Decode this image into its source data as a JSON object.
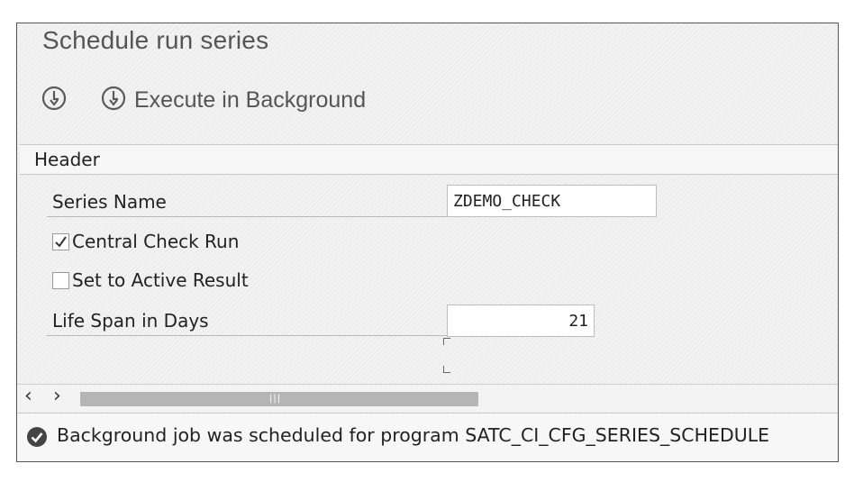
{
  "window": {
    "title": "Schedule run series"
  },
  "toolbar": {
    "execute_button_label": "Execute in Background",
    "execute_icon": "execute-clock-icon",
    "schedule_icon": "execute-clock-icon"
  },
  "header": {
    "title": "Header",
    "series_name": {
      "label": "Series Name",
      "value": "ZDEMO_CHECK"
    },
    "central_check_run": {
      "label": "Central Check Run",
      "checked": true
    },
    "set_active_result": {
      "label": "Set to Active Result",
      "checked": false
    },
    "life_span": {
      "label": "Life Span in Days",
      "value": "21"
    }
  },
  "scrollbar": {
    "left_arrow": "‹",
    "right_arrow": "›",
    "grip": "|||"
  },
  "status": {
    "icon": "success-check-icon",
    "message": "Background job was scheduled for program SATC_CI_CFG_SERIES_SCHEDULE"
  }
}
